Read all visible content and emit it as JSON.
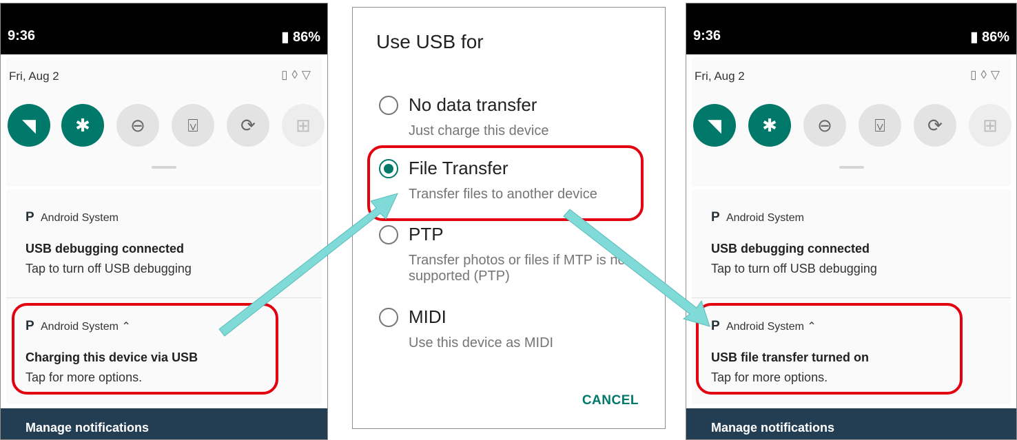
{
  "left_phone": {
    "status": {
      "time": "9:36",
      "battery": "86%"
    },
    "date": "Fri, Aug 2",
    "tiles": [
      "wifi-icon",
      "bluetooth-icon",
      "do-not-disturb-icon",
      "flashlight-icon",
      "auto-rotate-icon",
      "battery-saver-icon"
    ],
    "notifications": [
      {
        "app": "Android System",
        "title": "USB debugging connected",
        "text": "Tap to turn off USB debugging"
      },
      {
        "app": "Android System",
        "title": "Charging this device via USB",
        "text": "Tap for more options."
      }
    ],
    "manage": "Manage notifications"
  },
  "dialog": {
    "title": "Use USB for",
    "options": [
      {
        "label": "No data transfer",
        "sub": "Just charge this device",
        "selected": false
      },
      {
        "label": "File Transfer",
        "sub": "Transfer files to another device",
        "selected": true
      },
      {
        "label": "PTP",
        "sub": "Transfer photos or files if MTP is not supported (PTP)",
        "selected": false
      },
      {
        "label": "MIDI",
        "sub": "Use this device as MIDI",
        "selected": false
      }
    ],
    "cancel": "CANCEL"
  },
  "right_phone": {
    "status": {
      "time": "9:36",
      "battery": "86%"
    },
    "date": "Fri, Aug 2",
    "notifications": [
      {
        "app": "Android System",
        "title": "USB debugging connected",
        "text": "Tap to turn off USB debugging"
      },
      {
        "app": "Android System",
        "title": "USB file transfer turned on",
        "text": "Tap for more options."
      }
    ],
    "manage": "Manage notifications"
  },
  "colors": {
    "accent": "#00796b",
    "highlight": "#e3000f",
    "arrow": "#7fdad8",
    "footer": "#233e53"
  }
}
